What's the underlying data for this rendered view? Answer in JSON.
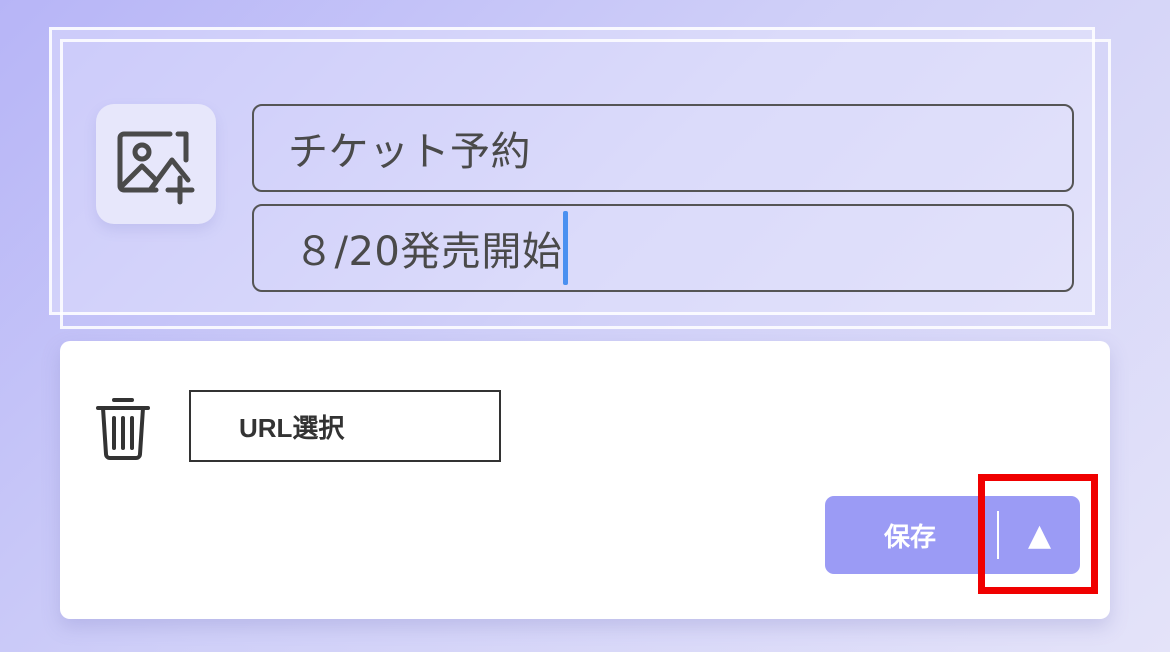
{
  "editor": {
    "image_icon": "image-add-icon",
    "title_value": "チケット予約",
    "subtitle_value": "８/20発売開始"
  },
  "actions": {
    "delete_icon": "trash-icon",
    "url_button_label": "URL選択",
    "save_label": "保存",
    "menu_toggle_icon": "triangle-up-icon",
    "menu_toggle_glyph": "▲"
  },
  "colors": {
    "accent": "#9b9bf5",
    "caret": "#4a90f0",
    "highlight": "#f00000",
    "background_start": "#b7b5f7",
    "background_end": "#e4e3f9"
  }
}
